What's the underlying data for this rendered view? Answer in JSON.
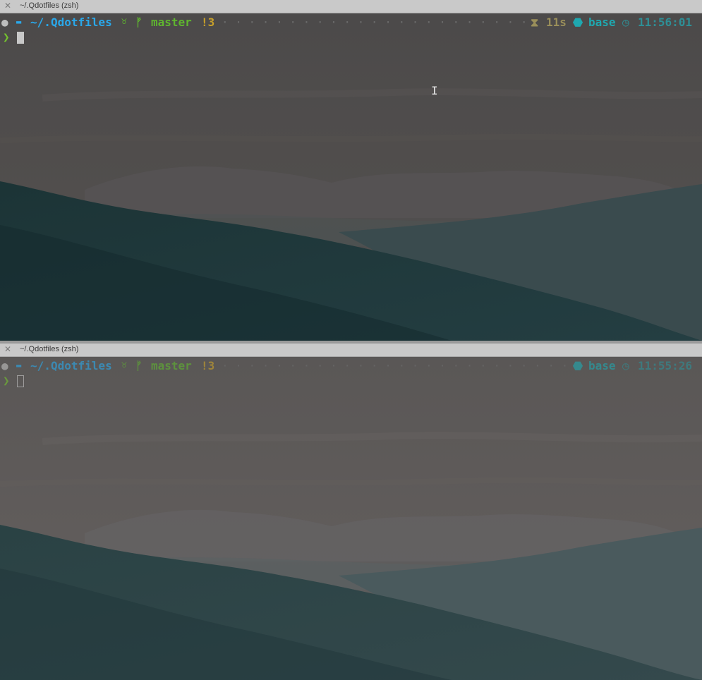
{
  "panes": {
    "top": {
      "tab_title": "~/.Qdotfiles (zsh)",
      "tab_close": "✕",
      "os_icon": "",
      "folder_icon": "▬",
      "path_prefix": "~/.",
      "path_bold": "Qdotfiles",
      "vcs_icon": "♉",
      "branch_icon": "ᚠ",
      "branch": "master",
      "git_status": "!3",
      "hourglass_icon": "⧗",
      "duration": "11s",
      "env_icon": "⬣",
      "env": "base",
      "clock_icon": "◷",
      "time": "11:56:01",
      "prompt_char": "❯",
      "active": true
    },
    "bottom": {
      "tab_title": "~/.Qdotfiles (zsh)",
      "tab_close": "✕",
      "os_icon": "",
      "folder_icon": "▬",
      "path_prefix": "~/.",
      "path_bold": "Qdotfiles",
      "vcs_icon": "♉",
      "branch_icon": "ᚠ",
      "branch": "master",
      "git_status": "!3",
      "env_icon": "⬣",
      "env": "base",
      "clock_icon": "◷",
      "time": "11:55:26",
      "prompt_char": "❯",
      "active": false
    }
  },
  "colors": {
    "path": "#2aa8ea",
    "vcs": "#5fb52f",
    "git_status": "#c8a02a",
    "duration": "#9a8f5a",
    "env": "#1fa8b0",
    "time": "#2e8f96",
    "prompt": "#74c22e"
  }
}
